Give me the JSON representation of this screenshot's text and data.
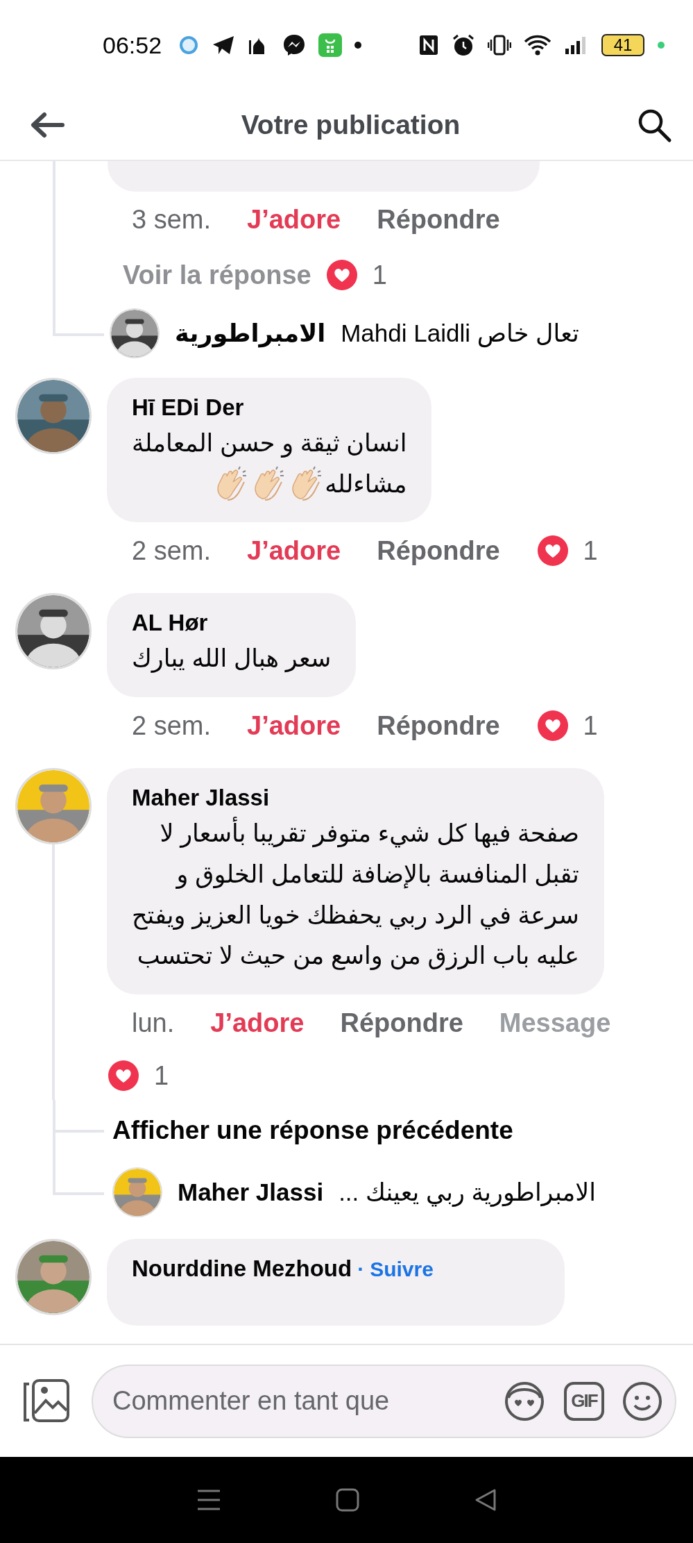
{
  "status_bar": {
    "time": "06:52",
    "battery": "41"
  },
  "header": {
    "title": "Votre publication"
  },
  "partial_thread": {
    "time": "3 sem.",
    "like": "J’adore",
    "reply": "Répondre",
    "view_reply": "Voir la réponse",
    "reactions": "1",
    "reply_preview": {
      "author": "الامبراطورية",
      "text": "تعال خاص Mahdi Laidli"
    }
  },
  "comments": [
    {
      "author": "Hī EDi Der",
      "body_lines": [
        "انسان ثيقة و حسن المعاملة",
        "مشاءلله"
      ],
      "emojis": [
        {
          "kind": "clap"
        },
        {
          "kind": "clap"
        },
        {
          "kind": "clap"
        }
      ],
      "time": "2 sem.",
      "like": "J’adore",
      "reply": "Répondre",
      "reactions": "1"
    },
    {
      "author": "AL Hør",
      "body_lines": [
        "سعر هبال الله يبارك"
      ],
      "time": "2 sem.",
      "like": "J’adore",
      "reply": "Répondre",
      "reactions": "1"
    },
    {
      "author": "Maher Jlassi",
      "body_lines": [
        "صفحة فيها كل شيء متوفر تقريبا بأسعار لا",
        "تقبل المنافسة بالإضافة للتعامل الخلوق و",
        "سرعة في الرد ربي يحفظك خويا العزيز ويفتح",
        "عليه باب الرزق من واسع من حيث لا تحتسب"
      ],
      "time": "lun.",
      "like": "J’adore",
      "reply": "Répondre",
      "message": "Message",
      "reactions": "1",
      "thread": {
        "more": "Afficher une réponse précédente",
        "reply_preview": {
          "author": "Maher Jlassi",
          "text": "الامبراطورية ربي يعينك ..."
        }
      }
    },
    {
      "author": "Nourddine Mezhoud",
      "separator": "·",
      "follow": "Suivre"
    }
  ],
  "composer": {
    "placeholder": "Commenter en tant que",
    "gif_label": "GIF"
  }
}
